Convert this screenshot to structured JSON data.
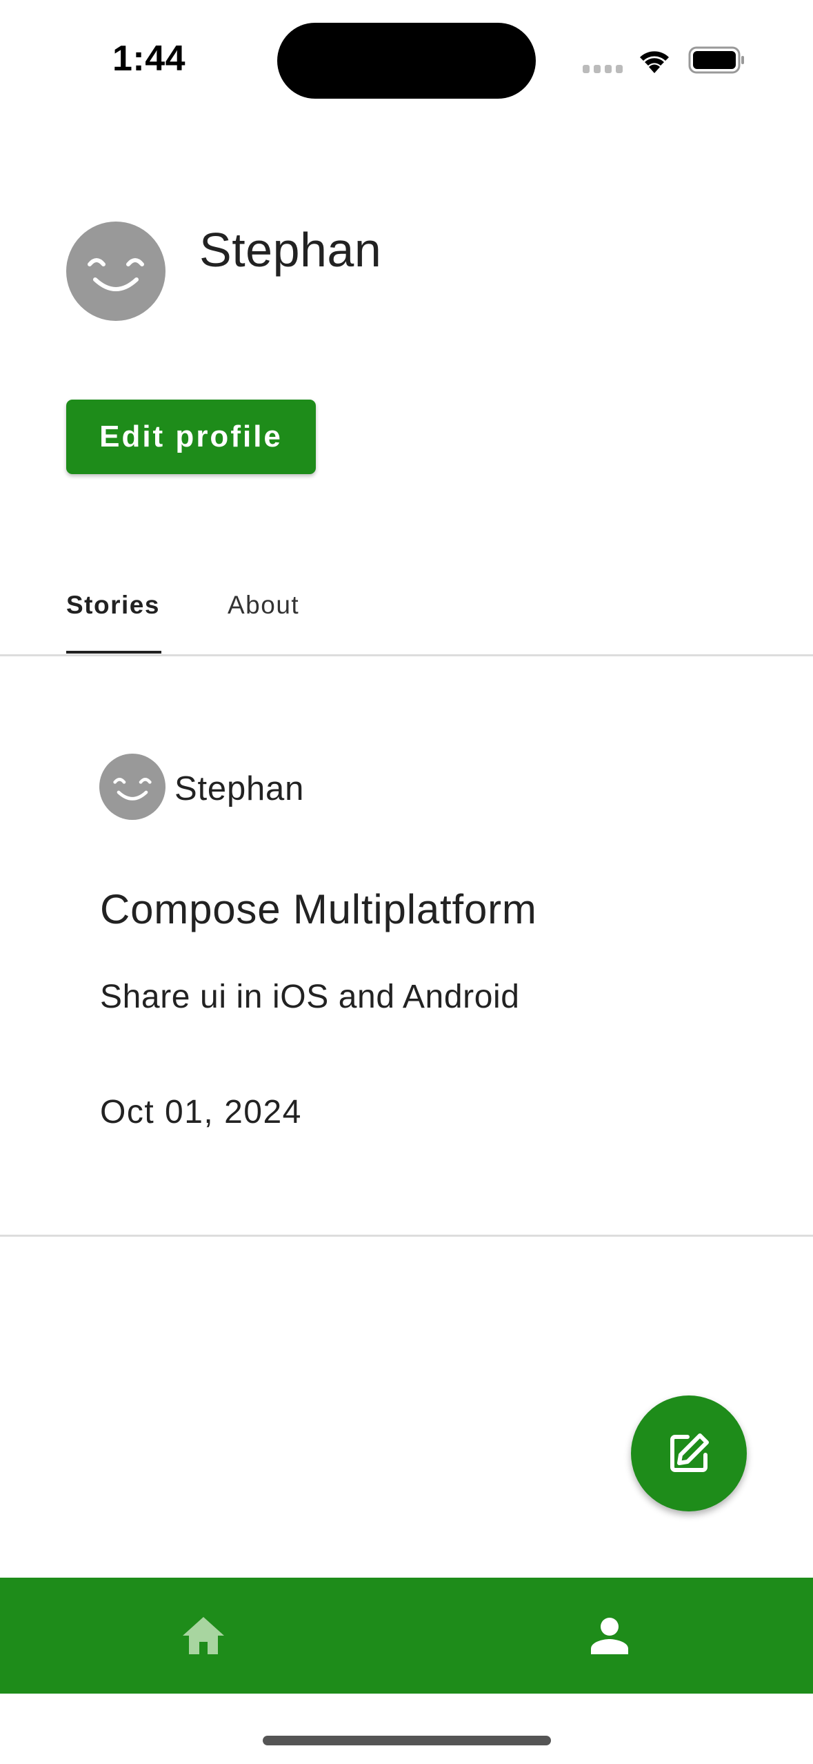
{
  "status_bar": {
    "time": "1:44"
  },
  "profile": {
    "name": "Stephan",
    "avatar_icon": "smiling-face-icon",
    "edit_button_label": "Edit profile"
  },
  "tabs": [
    {
      "label": "Stories",
      "selected": true
    },
    {
      "label": "About",
      "selected": false
    }
  ],
  "stories": [
    {
      "author": "Stephan",
      "title": "Compose Multiplatform",
      "subtitle": "Share ui in iOS and Android",
      "date": "Oct 01, 2024"
    }
  ],
  "fab": {
    "icon": "edit-icon"
  },
  "bottom_nav": {
    "items": [
      {
        "icon": "home-icon",
        "selected": false
      },
      {
        "icon": "person-icon",
        "selected": true
      }
    ]
  },
  "colors": {
    "accent": "#1e8c1a",
    "avatar": "#999999",
    "text": "#222222",
    "divider": "#dddddd",
    "nav_inactive_icon": "#a8d5a0",
    "nav_active_icon": "#ffffff"
  }
}
